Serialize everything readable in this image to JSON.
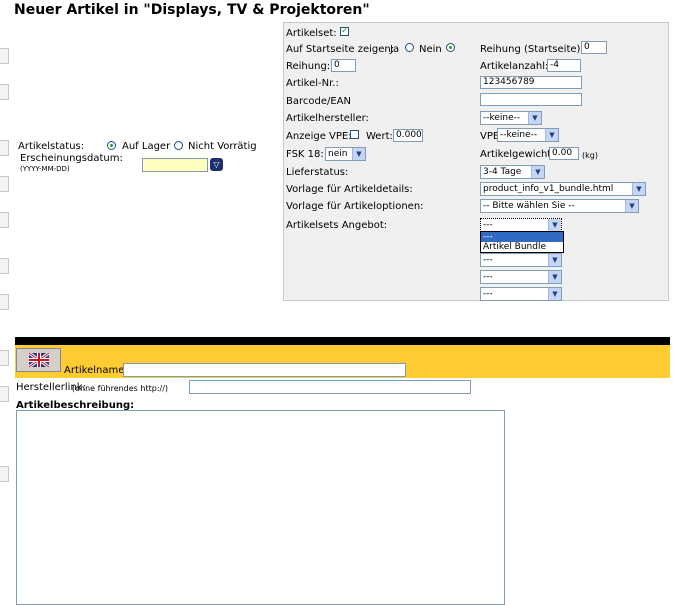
{
  "page": {
    "title": "Neuer Artikel in \"Displays, TV & Projektoren\""
  },
  "left": {
    "status_label": "Artikelstatus:",
    "status_in_stock": "Auf Lager",
    "status_not_available": "Nicht Vorrätig",
    "release_date_label": "Erscheinungsdatum:",
    "release_date_format": "(YYYY-MM-DD)",
    "release_date_value": ""
  },
  "panel": {
    "artikelset_label": "Artikelset:",
    "startpage_label": "Auf Startseite zeigen:",
    "yes_label": "Ja",
    "no_label": "Nein",
    "sort_startpage_label": "Reihung (Startseite):",
    "sort_startpage_value": "0",
    "sort_label": "Reihung:",
    "sort_value": "0",
    "quantity_label": "Artikelanzahl:",
    "quantity_value": "-4",
    "artnr_label": "Artikel-Nr.:",
    "artnr_value": "123456789",
    "barcode_label": "Barcode/EAN",
    "barcode_value": "",
    "manufacturer_label": "Artikelhersteller:",
    "manufacturer_value": "--keine--",
    "vpe_show_label": "Anzeige VPE:",
    "vpe_value_label": "Wert:",
    "vpe_value": "0.0000",
    "vpe_label": "VPE",
    "vpe_select": "--keine--",
    "fsk_label": "FSK 18:",
    "fsk_value": "nein",
    "weight_label": "Artikelgewicht:",
    "weight_value": "0.00",
    "weight_unit": "(kg)",
    "delivery_label": "Lieferstatus:",
    "delivery_value": "3-4 Tage",
    "template_details_label": "Vorlage für Artikeldetails:",
    "template_details_value": "product_info_v1_bundle.html",
    "template_options_label": "Vorlage für Artikeloptionen:",
    "template_options_value": "-- Bitte wählen Sie --",
    "sets_label": "Artikelsets Angebot:",
    "sets_selects": [
      "---",
      "---",
      "---",
      "---",
      "---"
    ],
    "sets_dropdown_options": [
      "---",
      "Artikel Bundle"
    ]
  },
  "lang": {
    "name_label": "Artikelname:",
    "name_value": "",
    "link_label": "Herstellerlink:",
    "link_hint": "(ohne führendes http://)",
    "link_value": "",
    "description_label": "Artikelbeschreibung:"
  }
}
